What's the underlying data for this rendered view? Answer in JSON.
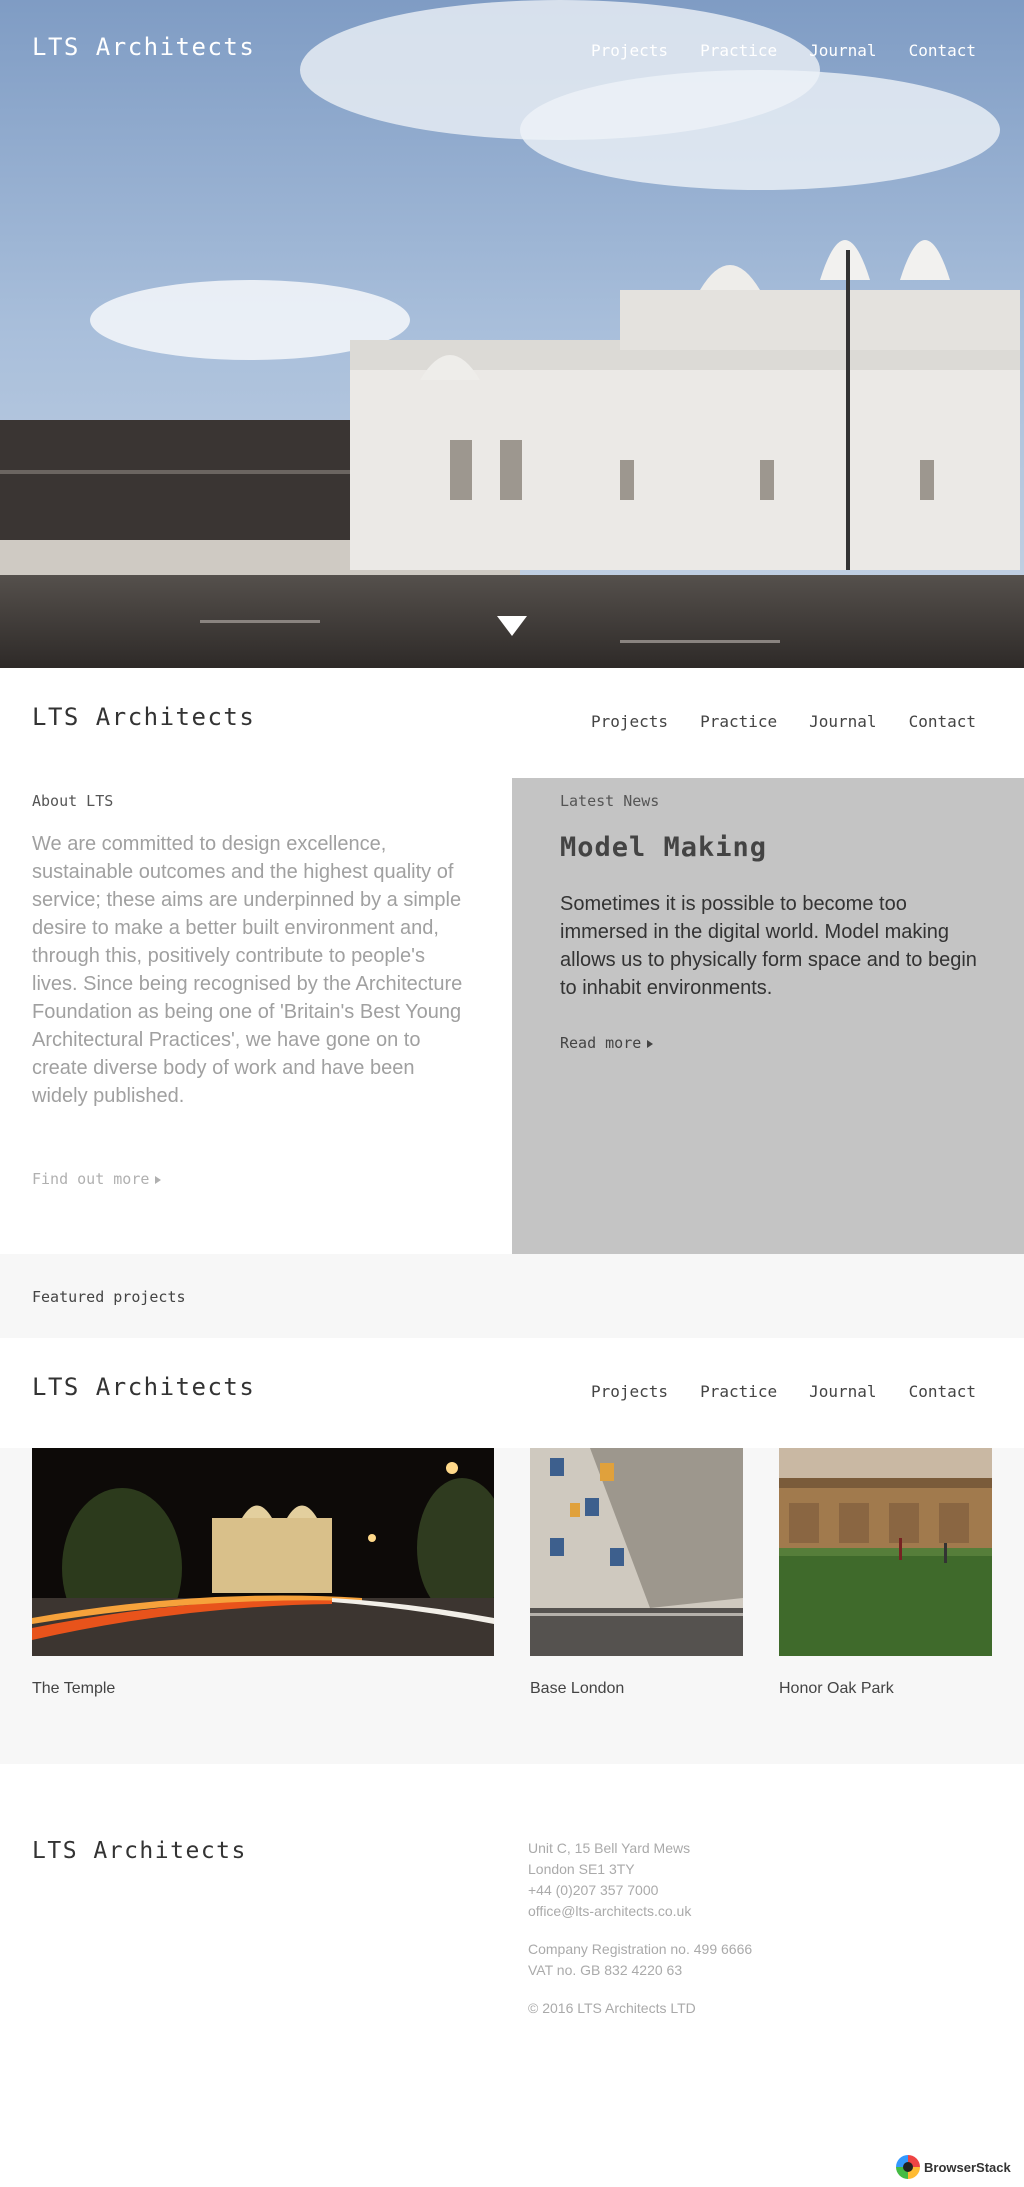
{
  "brand": {
    "name": "LTS Architects"
  },
  "nav": {
    "items": [
      "Projects",
      "Practice",
      "Journal",
      "Contact"
    ]
  },
  "about": {
    "label": "About LTS",
    "text": "We are committed to design excellence, sustainable outcomes and the highest quality of service; these aims are underpinned by a simple desire to make a better built environment and, through this, positively contribute to people's lives. Since being recognised by the Architecture Foundation as being one of 'Britain's Best Young Architectural Practices', we have gone on to create diverse body of work and have been widely published.",
    "link": "Find out more"
  },
  "news": {
    "label": "Latest News",
    "title": "Model Making",
    "text": "Sometimes it is possible to become too immersed in the digital world. Model making allows us to physically form space and to begin to inhabit environments.",
    "link": "Read more"
  },
  "featured": {
    "label": "Featured projects",
    "projects": [
      "The Temple",
      "Base London",
      "Honor Oak Park"
    ]
  },
  "footer": {
    "address": [
      "Unit C, 15 Bell Yard Mews",
      "London SE1 3TY",
      "+44 (0)207 357 7000",
      "office@lts-architects.co.uk"
    ],
    "company": [
      "Company Registration no. 499 6666",
      "VAT no. GB 832 4220 63"
    ],
    "copyright": "© 2016 LTS Architects LTD"
  },
  "badge": {
    "label": "BrowserStack"
  },
  "colors": {
    "news_bg": "#c4c4c4",
    "featured_bg": "#f7f7f7",
    "muted_text": "#a0a0a0"
  }
}
